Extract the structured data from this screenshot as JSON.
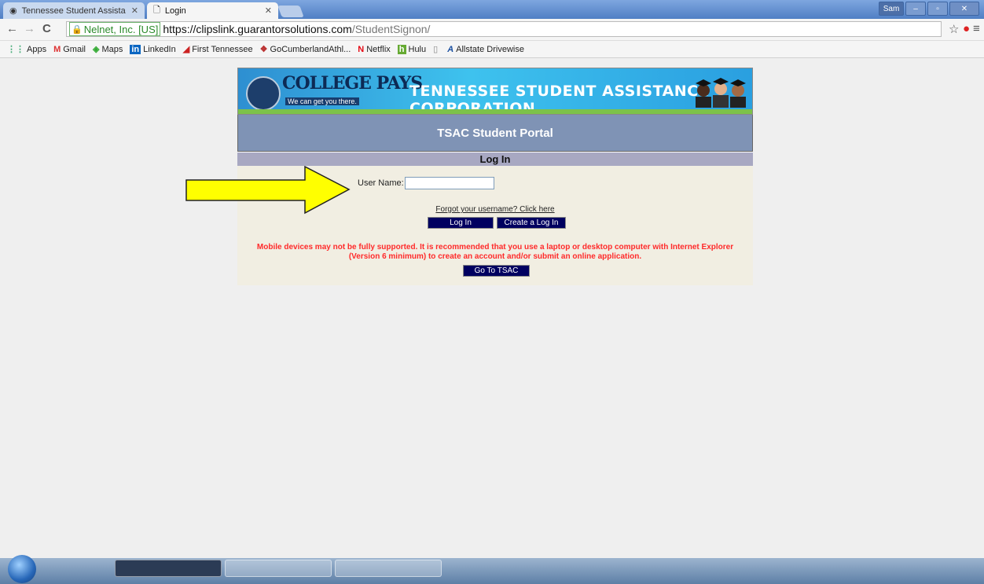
{
  "browser": {
    "tabs": [
      {
        "title": "Tennessee Student Assista",
        "active": false
      },
      {
        "title": "Login",
        "active": true
      }
    ],
    "user_badge": "Sam",
    "secure_label": "Nelnet, Inc. [US]",
    "url_scheme_host": "https://clipslink.guarantorsolutions.com",
    "url_path": "/StudentSignon/",
    "bookmarks": [
      "Apps",
      "Gmail",
      "Maps",
      "LinkedIn",
      "First Tennessee",
      "GoCumberlandAthl...",
      "Netflix",
      "Hulu",
      "",
      "Allstate Drivewise"
    ]
  },
  "banner": {
    "logo_text": "COLLEGE PAYS",
    "tagline": "We can get you there.",
    "org_title": "TENNESSEE STUDENT ASSISTANCE CORPORATION"
  },
  "portal": {
    "title": "TSAC Student Portal",
    "login_heading": "Log In",
    "username_label": "User Name:",
    "username_value": "",
    "forgot_link": "Forgot your username? Click here",
    "login_button": "Log In",
    "create_button": "Create a Log In",
    "warning_line1": "Mobile devices may not be fully supported. It is recommended that you use a laptop or desktop computer with Internet Explorer",
    "warning_line2": "(Version 6 minimum) to create an account and/or submit an online application.",
    "goto_button": "Go To TSAC"
  },
  "colors": {
    "portal_header": "#7f93b5",
    "button_bg": "#000060",
    "warning_text": "#ff2a2a",
    "arrow_fill": "#ffff00"
  }
}
